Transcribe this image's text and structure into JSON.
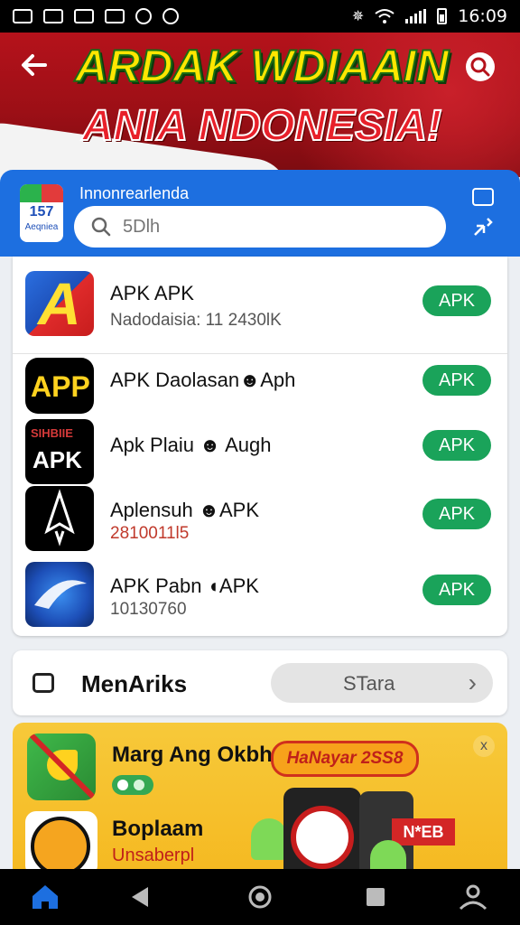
{
  "status_bar": {
    "time": "16:09"
  },
  "banner": {
    "title_line1": "ARDAK WDIAAIN",
    "title_line2": "ANIA NDONESIA!"
  },
  "header": {
    "label": "Innonrearlenda",
    "search_placeholder": "5Dlh",
    "logo_number": "157",
    "logo_caption": "Aeqniea"
  },
  "apps": [
    {
      "title": "APK APK",
      "subtitle": "Nadodaisia: 11 2430lK",
      "button": "APK",
      "icon": "a-logo-icon",
      "icon_text": "A"
    },
    {
      "title": "APK Daolasan☻Aph",
      "subtitle": "",
      "button": "APK",
      "icon": "app-icon",
      "icon_text": "APP"
    },
    {
      "title": "Apk Plaiu ☻ Augh",
      "subtitle": "",
      "button": "APK",
      "icon": "apk-icon",
      "icon_text": "APK",
      "icon_subtext": "SIHBIIE"
    },
    {
      "title": "Aplensuh ☻APK",
      "subtitle": "2810011l5",
      "button": "APK",
      "icon": "rocket-icon"
    },
    {
      "title": "APK Pabn ◖APK",
      "subtitle": "10130760",
      "button": "APK",
      "icon": "blue-swirl-icon"
    }
  ],
  "menu_bar": {
    "label": "MenAriks",
    "status_label": "STara",
    "chevron": "›"
  },
  "promo": {
    "title1": "Marg Ang Okbh",
    "badge": "HaNayar 2SS8",
    "title2": "Boplaam",
    "subtitle2": "Unsaberpl",
    "tag": "N*EB",
    "close": "x"
  },
  "colors": {
    "primary_blue": "#1d6fe0",
    "apk_green": "#1aa35a",
    "banner_red": "#b5121b",
    "promo_yellow": "#f7c93a"
  }
}
